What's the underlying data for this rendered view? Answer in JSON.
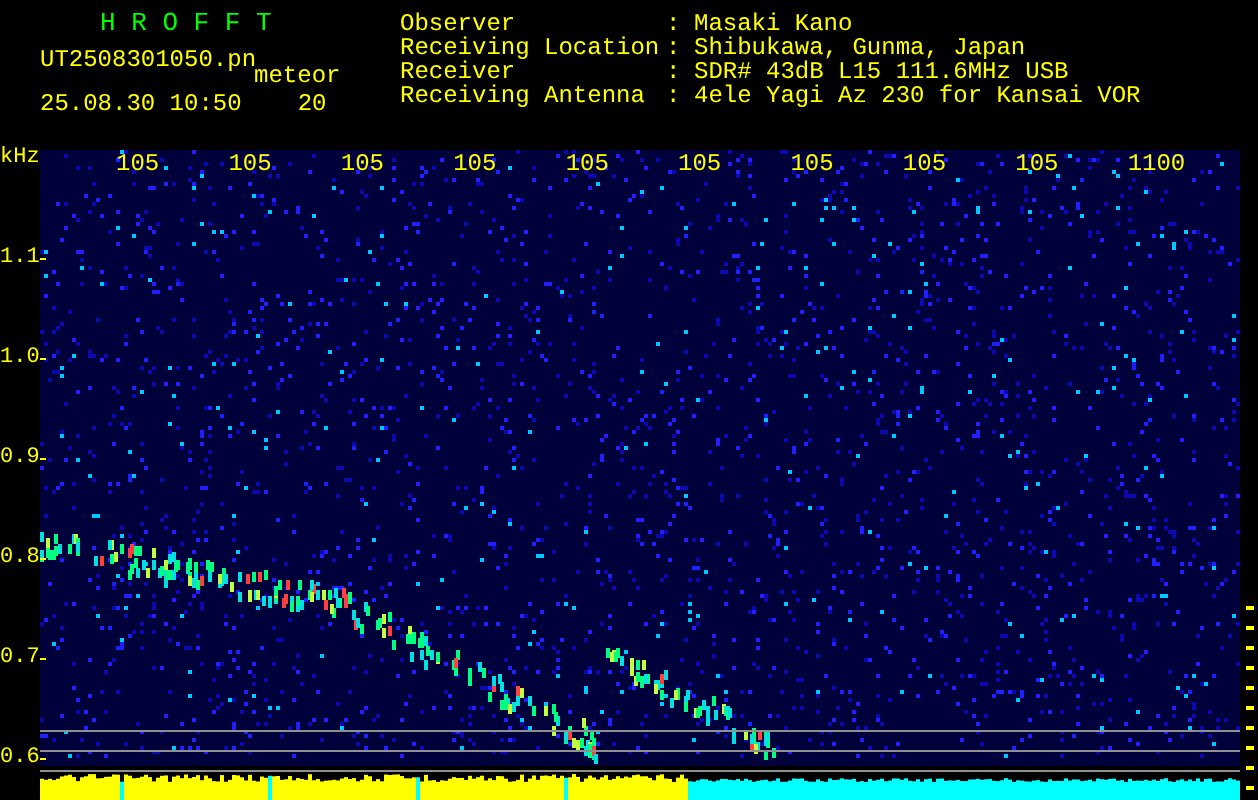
{
  "app_title": "H R O F F T",
  "file": {
    "name": "UT2508301050.pn",
    "type": "meteor",
    "timestamp": "25.08.30 10:50",
    "count": "20"
  },
  "info": [
    {
      "label": "Observer",
      "value": "Masaki Kano"
    },
    {
      "label": "Receiving Location",
      "value": "Shibukawa, Gunma, Japan"
    },
    {
      "label": "Receiver",
      "value": "SDR# 43dB L15 111.6MHz USB"
    },
    {
      "label": "Receiving Antenna",
      "value": "4ele Yagi Az 230 for Kansai VOR"
    }
  ],
  "separator": ":",
  "y_axis": {
    "unit": "kHz",
    "labels": [
      "1.1",
      "1.0",
      "0.9",
      "0.8",
      "0.7",
      "0.6"
    ]
  },
  "x_axis": {
    "labels": [
      "105",
      "105",
      "105",
      "105",
      "105",
      "105",
      "105",
      "105",
      "105",
      "1100"
    ]
  }
}
